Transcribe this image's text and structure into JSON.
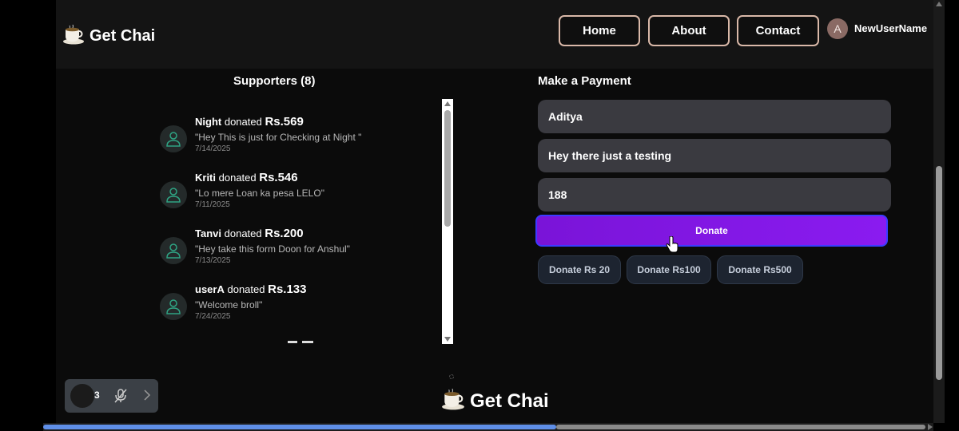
{
  "navbar": {
    "brand": "Get Chai",
    "links": [
      "Home",
      "About",
      "Contact"
    ],
    "avatar_letter": "A",
    "username": "NewUserName"
  },
  "supporters": {
    "title": "Supporters (8)",
    "items": [
      {
        "name": "Night",
        "verb": "donated",
        "amount": "Rs.569",
        "message": "\"Hey This is just for Checking at Night \"",
        "date": "7/14/2025"
      },
      {
        "name": "Kriti",
        "verb": "donated",
        "amount": "Rs.546",
        "message": "\"Lo mere Loan ka pesa LELO\"",
        "date": "7/11/2025"
      },
      {
        "name": "Tanvi",
        "verb": "donated",
        "amount": "Rs.200",
        "message": "\"Hey take this form Doon for Anshul\"",
        "date": "7/13/2025"
      },
      {
        "name": "userA",
        "verb": "donated",
        "amount": "Rs.133",
        "message": "\"Welcome broll\"",
        "date": "7/24/2025"
      }
    ]
  },
  "payment": {
    "title": "Make a Payment",
    "name_value": "Aditya",
    "message_value": "Hey there just a testing",
    "amount_value": "188",
    "donate_label": "Donate",
    "quick": [
      "Donate Rs 20",
      "Donate Rs100",
      "Donate Rs500"
    ]
  },
  "footer": {
    "brand": "Get Chai"
  },
  "widget": {
    "count": "3"
  },
  "colors": {
    "accent_purple": "#8a1bf0",
    "nav_border": "#d9b8a8",
    "field_bg": "#3a3a40"
  }
}
